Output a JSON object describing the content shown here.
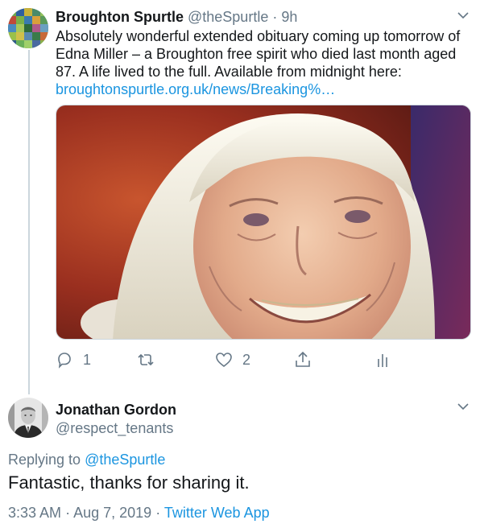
{
  "tweet": {
    "author_name": "Broughton Spurtle",
    "author_handle": "@theSpurtle",
    "separator": "·",
    "time": "9h",
    "text": "Absolutely wonderful extended obituary coming up tomorrow of Edna Miller – a Broughton free spirit who died last month aged 87. A life lived to the full. Available from midnight here:",
    "link": "broughtonspurtle.org.uk/news/Breaking%…",
    "reply_count": "1",
    "like_count": "2"
  },
  "reply": {
    "author_name": "Jonathan Gordon",
    "author_handle": "@respect_tenants",
    "replying_prefix": "Replying to",
    "replying_to": "@theSpurtle",
    "text": "Fantastic, thanks for sharing it.",
    "time": "3:33 AM",
    "separator1": "·",
    "date": "Aug 7, 2019",
    "separator2": "·",
    "source": "Twitter Web App"
  },
  "colors": {
    "link": "#1b95e0",
    "secondary_text": "#657786",
    "thread_line": "#ccd6dd"
  },
  "icons": [
    "chevron-down-icon",
    "reply-icon",
    "retweet-icon",
    "like-icon",
    "share-icon",
    "analytics-icon"
  ]
}
